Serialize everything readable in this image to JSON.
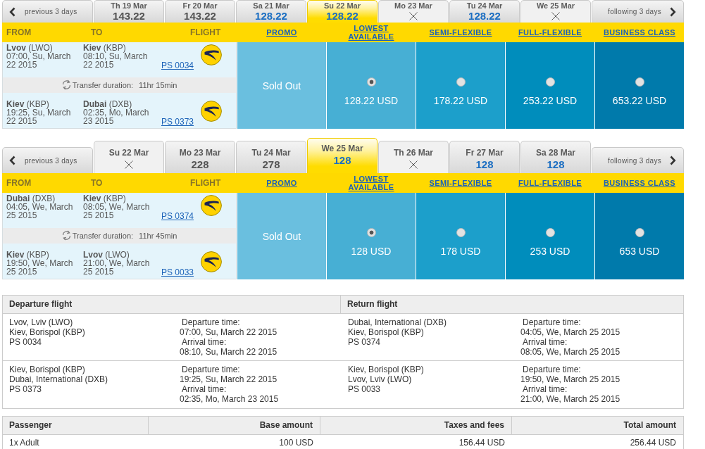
{
  "journeys": [
    {
      "date_strip": {
        "previous": "previous 3 days",
        "days": [
          {
            "date": "Th 19 Mar",
            "available": true,
            "price": "143.22",
            "lowest": false,
            "selected": false
          },
          {
            "date": "Fr 20 Mar",
            "available": true,
            "price": "143.22",
            "lowest": false,
            "selected": false
          },
          {
            "date": "Sa 21 Mar",
            "available": true,
            "price": "128.22",
            "lowest": true,
            "selected": false
          },
          {
            "date": "Su 22 Mar",
            "available": true,
            "price": "128.22",
            "lowest": true,
            "selected": true
          },
          {
            "date": "Mo 23 Mar",
            "available": false,
            "selected": false
          },
          {
            "date": "Tu 24 Mar",
            "available": true,
            "price": "128.22",
            "lowest": true,
            "selected": false
          },
          {
            "date": "We 25 Mar",
            "available": false,
            "selected": false
          }
        ],
        "following": "following 3 days"
      },
      "headers": {
        "from": "FROM",
        "to": "TO",
        "flight": "FLIGHT"
      },
      "fare_classes": [
        "PROMO",
        "LOWEST AVAILABLE",
        "SEMI-FLEXIBLE",
        "FULL-FLEXIBLE",
        "BUSINESS CLASS"
      ],
      "segments": [
        {
          "from": "**Lvov** (LWO)",
          "departure": "07:00, Su, March 22 2015",
          "to": "**Kiev** (KBP)",
          "arrival": "08:10, Su, March 22 2015",
          "flight": "PS 0034"
        },
        {
          "from": "**Kiev** (KBP)",
          "departure": "19:25, Su, March 22 2015",
          "to": "**Dubai** (DXB)",
          "arrival": "02:35, Mo, March 23 2015",
          "flight": "PS 0373"
        }
      ],
      "transfer": {
        "label": "Transfer duration:",
        "duration": "11hr 15min"
      },
      "fares": [
        {
          "kind": "sold_out",
          "text": "Sold Out"
        },
        {
          "kind": "option",
          "price": "128.22 USD",
          "selected": true
        },
        {
          "kind": "option",
          "price": "178.22 USD",
          "selected": false
        },
        {
          "kind": "option",
          "price": "253.22 USD",
          "selected": false
        },
        {
          "kind": "option",
          "price": "653.22 USD",
          "selected": false
        }
      ]
    },
    {
      "date_strip": {
        "previous": "previous 3 days",
        "days": [
          {
            "date": "Su 22 Mar",
            "available": false,
            "selected": false
          },
          {
            "date": "Mo 23 Mar",
            "available": true,
            "price": "228",
            "lowest": false,
            "selected": false
          },
          {
            "date": "Tu 24 Mar",
            "available": true,
            "price": "278",
            "lowest": false,
            "selected": false
          },
          {
            "date": "We 25 Mar",
            "available": true,
            "price": "128",
            "lowest": true,
            "selected": true
          },
          {
            "date": "Th 26 Mar",
            "available": false,
            "selected": false
          },
          {
            "date": "Fr 27 Mar",
            "available": true,
            "price": "128",
            "lowest": true,
            "selected": false
          },
          {
            "date": "Sa 28 Mar",
            "available": true,
            "price": "128",
            "lowest": true,
            "selected": false
          }
        ],
        "following": "following 3 days"
      },
      "headers": {
        "from": "FROM",
        "to": "TO",
        "flight": "FLIGHT"
      },
      "fare_classes": [
        "PROMO",
        "LOWEST AVAILABLE",
        "SEMI-FLEXIBLE",
        "FULL-FLEXIBLE",
        "BUSINESS CLASS"
      ],
      "segments": [
        {
          "from": "**Dubai** (DXB)",
          "departure": "04:05, We, March 25 2015",
          "to": "**Kiev** (KBP)",
          "arrival": "08:05, We, March 25 2015",
          "flight": "PS 0374"
        },
        {
          "from": "**Kiev** (KBP)",
          "departure": "19:50, We, March 25 2015",
          "to": "**Lvov** (LWO)",
          "arrival": "21:00, We, March 25 2015",
          "flight": "PS 0033"
        }
      ],
      "transfer": {
        "label": "Transfer duration:",
        "duration": "11hr 45min"
      },
      "fares": [
        {
          "kind": "sold_out",
          "text": "Sold Out"
        },
        {
          "kind": "option",
          "price": "128 USD",
          "selected": true
        },
        {
          "kind": "option",
          "price": "178 USD",
          "selected": false
        },
        {
          "kind": "option",
          "price": "253 USD",
          "selected": false
        },
        {
          "kind": "option",
          "price": "653 USD",
          "selected": false
        }
      ]
    }
  ],
  "summary": {
    "departure": {
      "title": "Departure flight",
      "segments": [
        {
          "from": "Lvov, Lviv (LWO)",
          "to": "Kiev, Borispol (KBP)",
          "flight": "PS 0034",
          "departure_label": "Departure time:",
          "departure_time": "07:00, Su, March 22 2015",
          "arrival_label": "Arrival time:",
          "arrival_time": "08:10, Su, March 22 2015"
        },
        {
          "from": "Kiev, Borispol (KBP)",
          "to": "Dubai, International (DXB)",
          "flight": "PS 0373",
          "departure_label": "Departure time:",
          "departure_time": "19:25, Su, March 22 2015",
          "arrival_label": "Arrival time:",
          "arrival_time": "02:35, Mo, March 23 2015"
        }
      ]
    },
    "return": {
      "title": "Return flight",
      "segments": [
        {
          "from": "Dubai, International (DXB)",
          "to": "Kiev, Borispol (KBP)",
          "flight": "PS 0374",
          "departure_label": "Departure time:",
          "departure_time": "04:05, We, March 25 2015",
          "arrival_label": "Arrival time:",
          "arrival_time": "08:05, We, March 25 2015"
        },
        {
          "from": "Kiev, Borispol (KBP)",
          "to": "Lvov, Lviv (LWO)",
          "flight": "PS 0033",
          "departure_label": "Departure time:",
          "departure_time": "19:50, We, March 25 2015",
          "arrival_label": "Arrival time:",
          "arrival_time": "21:00, We, March 25 2015"
        }
      ]
    }
  },
  "price_table": {
    "columns": [
      "Passenger",
      "Base amount",
      "Taxes and fees",
      "Total amount"
    ],
    "rows": [
      [
        "1x Adult",
        "100 USD",
        "156.44 USD",
        "256.44 USD"
      ]
    ]
  }
}
